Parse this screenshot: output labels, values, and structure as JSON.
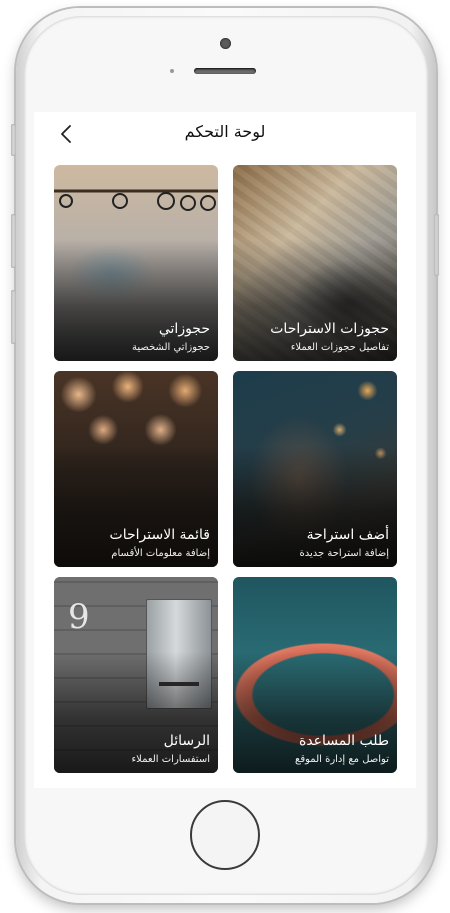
{
  "header": {
    "title": "لوحة التحكم"
  },
  "cards": [
    {
      "title": "حجوزات الاستراحات",
      "subtitle": "تفاصيل حجوزات العملاء",
      "icon": "photo-drafting-tools"
    },
    {
      "title": "حجوزاتي",
      "subtitle": "حجوزاتي الشخصية",
      "icon": "photo-clips"
    },
    {
      "title": "أضف استراحة",
      "subtitle": "إضافة استراحة جديدة",
      "icon": "photo-hand-lights"
    },
    {
      "title": "قائمة الاستراحات",
      "subtitle": "إضافة معلومات الأقسام",
      "icon": "photo-globes"
    },
    {
      "title": "طلب المساعدة",
      "subtitle": "تواصل مع إدارة الموقع",
      "icon": "photo-lifebuoy"
    },
    {
      "title": "الرسائل",
      "subtitle": "استفسارات العملاء",
      "icon": "photo-mailbox"
    }
  ],
  "mailbox_number": "9"
}
